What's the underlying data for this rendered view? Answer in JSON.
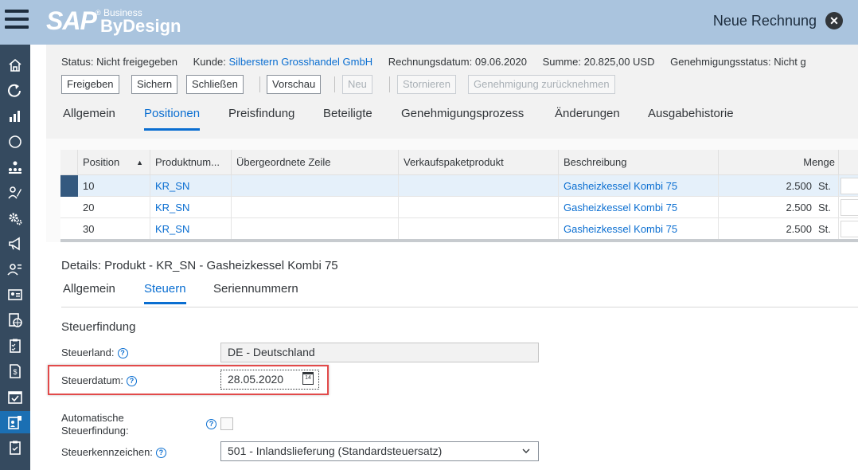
{
  "shell": {
    "logo_sap": "SAP",
    "logo_reg": "®",
    "logo_business": "Business",
    "logo_bydesign": "ByDesign",
    "title": "Neue Rechnung",
    "close_glyph": "✕"
  },
  "nav": {
    "icons": [
      "home-icon",
      "refresh-icon",
      "bar-chart-icon",
      "circle-icon",
      "org-chart-icon",
      "person-edit-icon",
      "gear-icon",
      "megaphone-icon",
      "person-list-icon",
      "id-card-icon",
      "globe-document-icon",
      "checklist-icon",
      "money-document-icon",
      "calendar-check-icon",
      "invoice-icon",
      "clipboard-icon"
    ],
    "active_index": 14
  },
  "header": {
    "status_label": "Status:",
    "status_value": "Nicht freigegeben",
    "customer_label": "Kunde:",
    "customer_value": "Silberstern Grosshandel GmbH",
    "invoice_date_label": "Rechnungsdatum:",
    "invoice_date_value": "09.06.2020",
    "sum_label": "Summe:",
    "sum_value": "20.825,00 USD",
    "approval_label": "Genehmigungsstatus:",
    "approval_value": "Nicht g"
  },
  "toolbar": {
    "release": "Freigeben",
    "save": "Sichern",
    "close": "Schließen",
    "preview": "Vorschau",
    "new": "Neu",
    "cancel": "Stornieren",
    "withdraw_approval": "Genehmigung zurücknehmen"
  },
  "tabs": [
    "Allgemein",
    "Positionen",
    "Preisfindung",
    "Beteiligte",
    "Genehmigungsprozess",
    "Änderungen",
    "Ausgabehistorie"
  ],
  "table": {
    "columns": [
      "Position",
      "Produktnum...",
      "Übergeordnete Zeile",
      "Verkaufspaketprodukt",
      "Beschreibung",
      "Menge"
    ],
    "sort_glyph": "▲",
    "rows": [
      {
        "position": "10",
        "product": "KR_SN",
        "parent": "",
        "package": "",
        "description": "Gasheizkessel Kombi 75",
        "quantity": "2.500",
        "unit": "St."
      },
      {
        "position": "20",
        "product": "KR_SN",
        "parent": "",
        "package": "",
        "description": "Gasheizkessel Kombi 75",
        "quantity": "2.500",
        "unit": "St."
      },
      {
        "position": "30",
        "product": "KR_SN",
        "parent": "",
        "package": "",
        "description": "Gasheizkessel Kombi 75",
        "quantity": "2.500",
        "unit": "St."
      }
    ]
  },
  "details": {
    "title": "Details: Produkt - KR_SN - Gasheizkessel Kombi 75",
    "tabs": [
      "Allgemein",
      "Steuern",
      "Seriennummern"
    ],
    "section_title": "Steuerfindung",
    "tax_country_label": "Steuerland:",
    "tax_country_value": "DE - Deutschland",
    "tax_date_label": "Steuerdatum:",
    "tax_date_value": "28.05.2020",
    "calendar_glyph": "14",
    "auto_tax_label_1": "Automatische",
    "auto_tax_label_2": "Steuerfindung:",
    "tax_code_label": "Steuerkennzeichen:",
    "tax_code_value": "501 - Inlandslieferung (Standardsteuersatz)",
    "help_glyph": "?"
  }
}
